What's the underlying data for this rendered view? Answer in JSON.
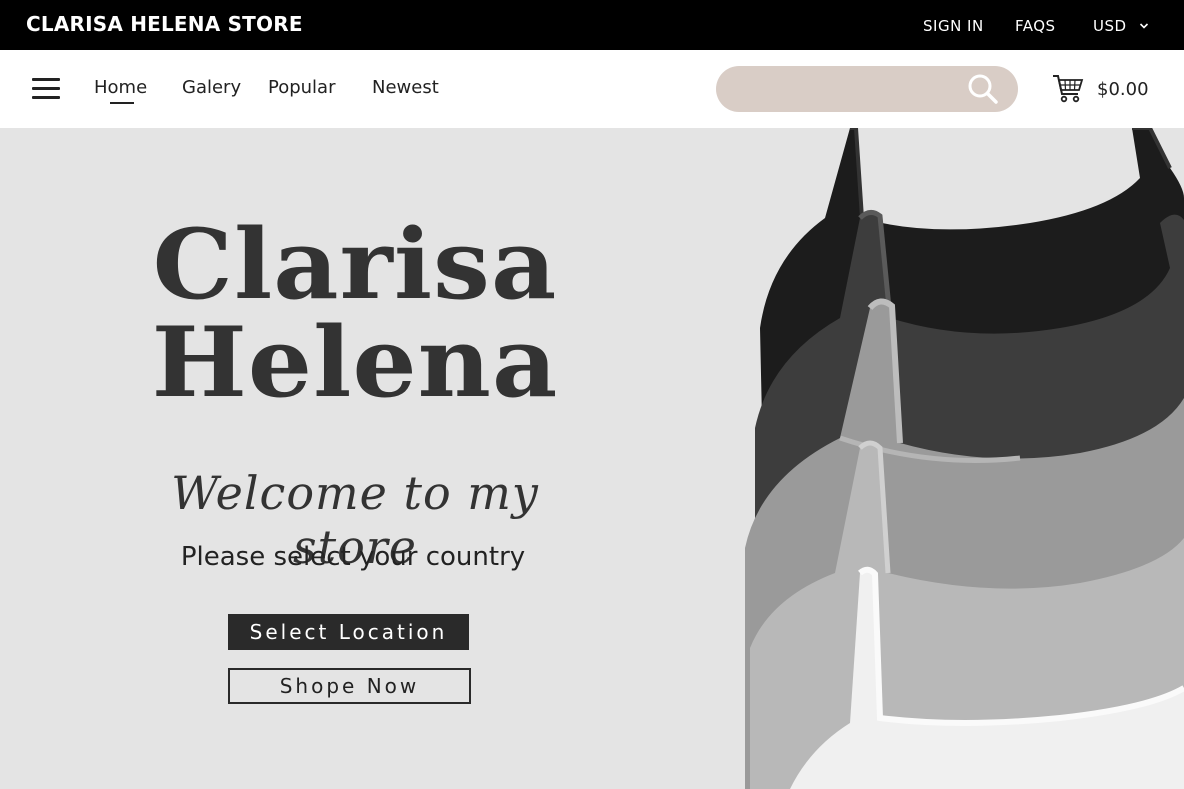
{
  "topbar": {
    "brand": "CLARISA HELENA STORE",
    "sign_in": "SIGN IN",
    "faqs": "FAQS",
    "currency": "USD"
  },
  "nav": {
    "items": [
      {
        "label": "Home",
        "active": true
      },
      {
        "label": "Galery"
      },
      {
        "label": "Popular"
      },
      {
        "label": "Newest"
      }
    ],
    "search": {
      "placeholder": "",
      "value": ""
    },
    "cart_total": "$0.00"
  },
  "hero": {
    "title_line1": "Clarisa",
    "title_line2": "Helena",
    "welcome": "Welcome to my store",
    "prompt": "Please select your country",
    "select_button": "Select Location",
    "shop_button": "Shope Now"
  },
  "colors": {
    "topbar_bg": "#000000",
    "search_bg": "#d9cdc6",
    "hero_bg": "#e4e4e4",
    "button_dark": "#2a2a2a"
  },
  "icons": {
    "menu": "hamburger-menu-icon",
    "search": "search-icon",
    "cart": "cart-icon",
    "currency_chevron": "chevron-down-icon"
  }
}
